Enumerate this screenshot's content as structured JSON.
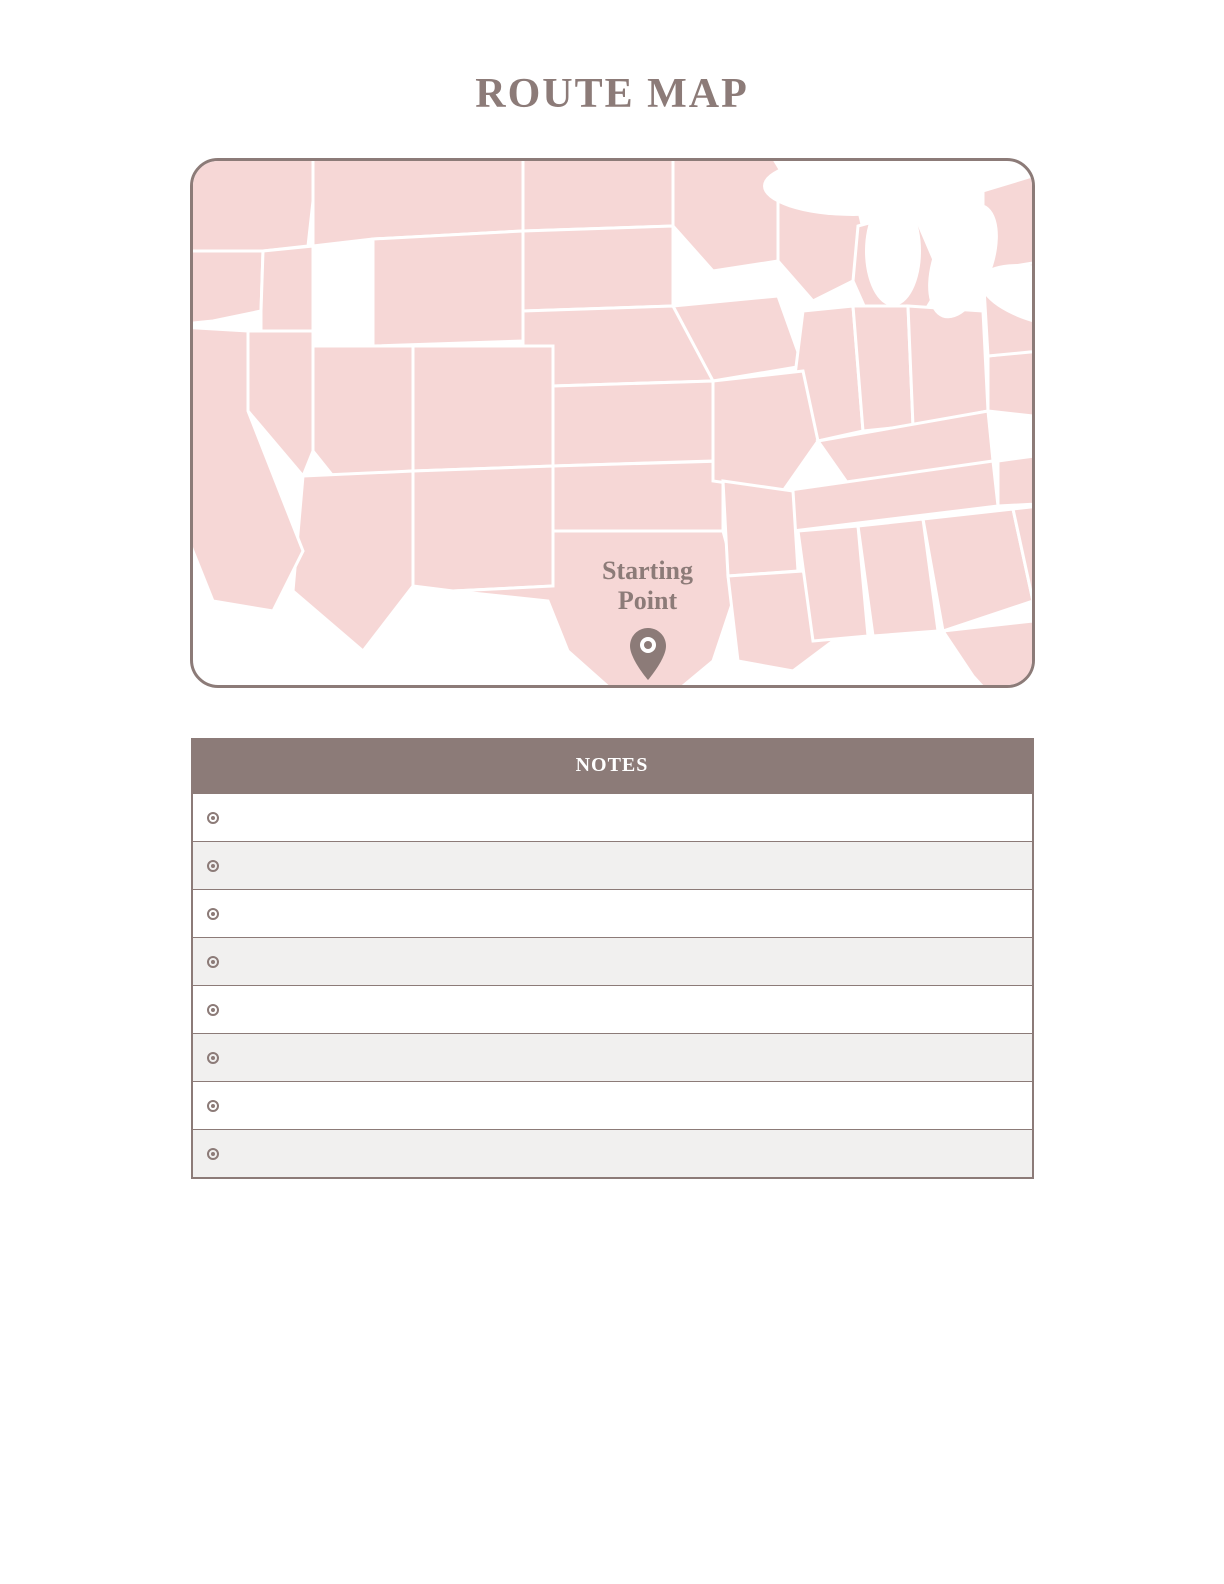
{
  "title": "ROUTE MAP",
  "map": {
    "pin_label_line1": "Starting",
    "pin_label_line2": "Point",
    "colors": {
      "state_fill": "#f6d7d6",
      "state_stroke": "#ffffff",
      "pin": "#8c7b78"
    }
  },
  "notes": {
    "header": "NOTES",
    "rows": [
      {
        "text": ""
      },
      {
        "text": ""
      },
      {
        "text": ""
      },
      {
        "text": ""
      },
      {
        "text": ""
      },
      {
        "text": ""
      },
      {
        "text": ""
      },
      {
        "text": ""
      }
    ]
  }
}
